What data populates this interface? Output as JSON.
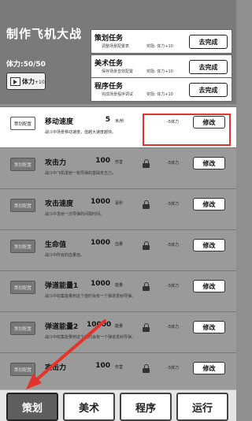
{
  "header": {
    "title": "制作飞机大战",
    "stamina": "体力:50/50",
    "video_button": {
      "label": "体力",
      "bonus": "+10",
      "icon": "video-icon"
    }
  },
  "tasks": [
    {
      "name": "策划任务",
      "desc": "调整场景配置表",
      "reward": "奖励: 体力+10",
      "button": "去完成"
    },
    {
      "name": "美术任务",
      "desc": "保存场景音效配置",
      "reward": "奖励: 体力+10",
      "button": "去完成"
    },
    {
      "name": "程序任务",
      "desc": "完成场景程序调试",
      "reward": "奖励: 体力+10",
      "button": "去完成"
    }
  ],
  "params": [
    {
      "thumb": "策划配置",
      "name": "移动速度",
      "value": "5",
      "unit": "米/秒",
      "desc": "战斗中场景移动速度，值越大速度越快。",
      "cost": "-5体力",
      "button": "修改",
      "locked": false,
      "active": true
    },
    {
      "thumb": "策划配置",
      "name": "攻击力",
      "value": "100",
      "unit": "伤害",
      "desc": "战斗中飞机发射一枚导弹的基础攻击力。",
      "cost": "-5体力",
      "button": "修改",
      "locked": true,
      "active": false
    },
    {
      "thumb": "策划配置",
      "name": "攻击速度",
      "value": "1000",
      "unit": "毫秒",
      "desc": "战斗中发射一次导弹的间隔时间。",
      "cost": "-5体力",
      "button": "修改",
      "locked": true,
      "active": false
    },
    {
      "thumb": "策划配置",
      "name": "生命值",
      "value": "1000",
      "unit": "血量",
      "desc": "战斗中所有的血量值。",
      "cost": "-5体力",
      "button": "修改",
      "locked": true,
      "active": false
    },
    {
      "thumb": "策划配置",
      "name": "弹道能量1",
      "value": "1000",
      "unit": "能量",
      "desc": "战斗中收集能量到这个值时会有一个弹道发射导弹。",
      "cost": "-5体力",
      "button": "修改",
      "locked": true,
      "active": false
    },
    {
      "thumb": "策划配置",
      "name": "弹道能量2",
      "value": "10000",
      "unit": "能量",
      "desc": "战斗中收集能量到这个值时会有一个弹道发射导弹。",
      "cost": "-5体力",
      "button": "修改",
      "locked": true,
      "active": false
    },
    {
      "thumb": "策划配置",
      "name": "攻击力",
      "value": "100",
      "unit": "伤害",
      "desc": "",
      "cost": "-5体力",
      "button": "修改",
      "locked": true,
      "active": false
    }
  ],
  "tabs": [
    {
      "label": "策划",
      "active": true
    },
    {
      "label": "美术",
      "active": false
    },
    {
      "label": "程序",
      "active": false
    },
    {
      "label": "运行",
      "active": false
    }
  ],
  "colors": {
    "highlight": "#e4332a",
    "active_tab": "#5e5e5e"
  }
}
